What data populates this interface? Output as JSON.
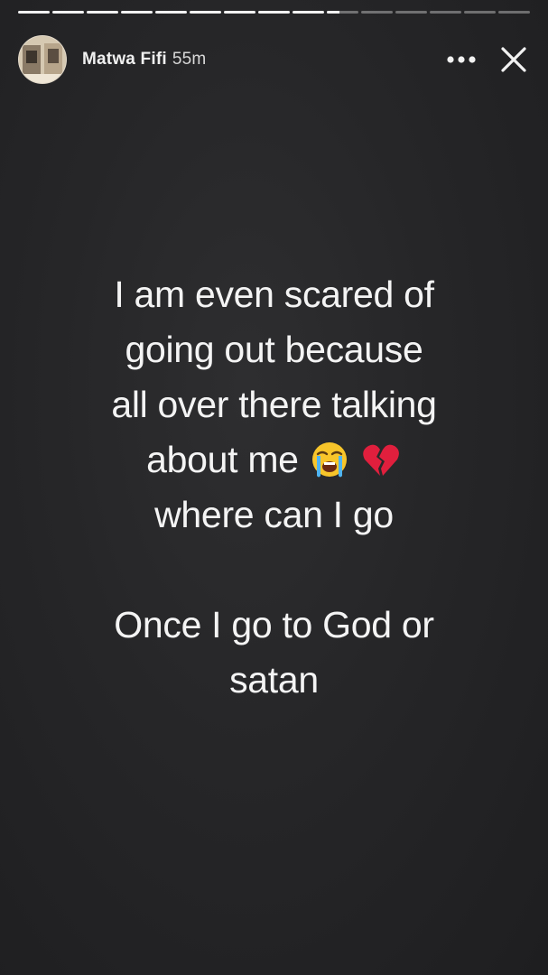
{
  "story": {
    "progress": {
      "segments": [
        1,
        1,
        1,
        1,
        1,
        1,
        1,
        1,
        1,
        0.4,
        0,
        0,
        0,
        0,
        0
      ]
    },
    "author": {
      "name": "Matwa Fifi",
      "time_ago": "55m",
      "avatar": "profile-photo"
    },
    "actions": {
      "more_icon": "more-horizontal-icon",
      "close_icon": "close-icon"
    },
    "text": {
      "line1": "I am even scared of",
      "line2": "going out because",
      "line3": "all over there talking",
      "line4": "about me",
      "line5": "where can I go",
      "line6": "Once I go to God or",
      "line7": "satan"
    },
    "emojis": [
      "loudly-crying-face-emoji",
      "broken-heart-emoji"
    ],
    "colors": {
      "background": "#262628",
      "text": "#f4f4f4"
    }
  }
}
